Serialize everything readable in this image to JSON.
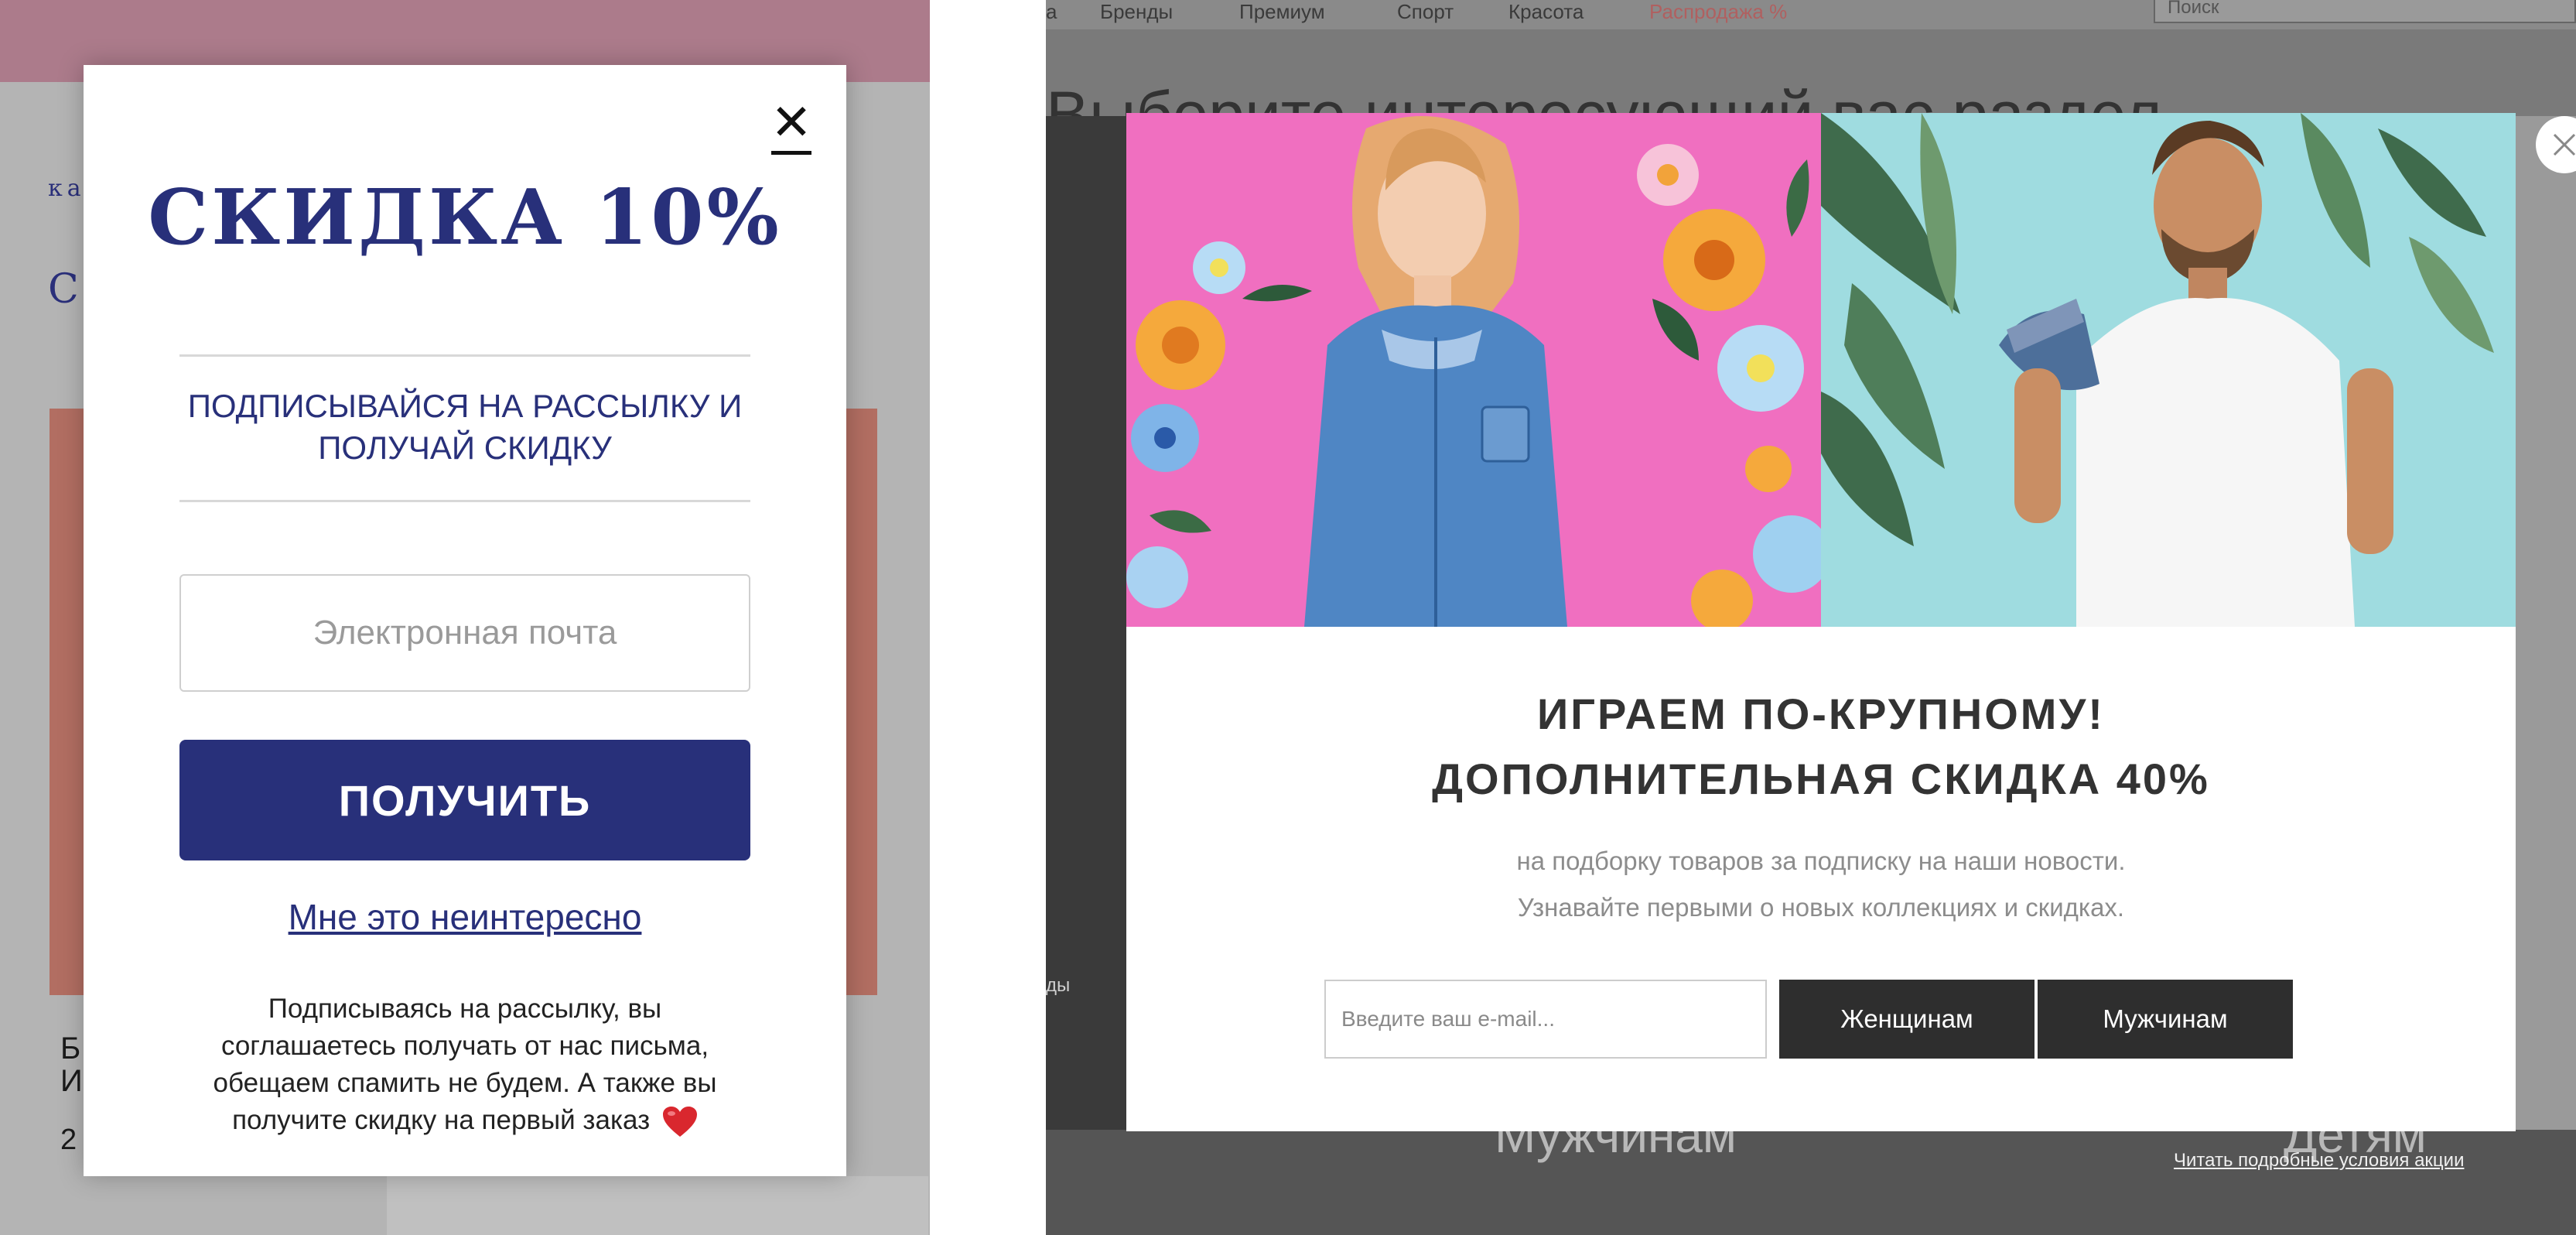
{
  "left_panel": {
    "background": {
      "text_ka": "ка",
      "text_c": "С",
      "text_b": "Б\nИ",
      "text_2": "2"
    },
    "popup": {
      "title": "СКИДКА 10%",
      "subtitle": "ПОДПИСЫВАЙСЯ НА РАССЫЛКУ И ПОЛУЧАЙ СКИДКУ",
      "email_placeholder": "Электронная почта",
      "email_value": "",
      "submit_label": "ПОЛУЧИТЬ",
      "decline_label": "Мне это неинтересно",
      "disclaimer": "Подписываясь на рассылку, вы соглашаетесь получать от нас письма, обещаем спамить не будем. А также вы получите скидку на первый заказ",
      "close_icon": "close-icon",
      "heart_icon": "heart-icon",
      "colors": {
        "brand": "#28307a",
        "topbar": "#ac7b8b",
        "overlay": "#b4b4b4"
      }
    }
  },
  "right_panel": {
    "background": {
      "nav_items": [
        "а",
        "Бренды",
        "Премиум",
        "Спорт",
        "Красота",
        "Распродажа %"
      ],
      "search_placeholder": "Поиск",
      "heading": "Выберите интересующий вас раздел",
      "side_label": "ды",
      "section_men": "Мужчинам",
      "section_kids": "Детям",
      "terms_link": "Читать подробные условия акции"
    },
    "popup": {
      "headline_1": "ИГРАЕМ ПО-КРУПНОМУ!",
      "headline_2": "ДОПОЛНИТЕЛЬНАЯ СКИДКА 40%",
      "desc_1": "на подборку товаров за подписку на наши новости.",
      "desc_2": "Узнавайте первыми о новых коллекциях и скидках.",
      "email_placeholder": "Введите ваш e-mail...",
      "email_value": "",
      "btn_women": "Женщинам",
      "btn_men": "Мужчинам",
      "close_icon": "close-circle-icon",
      "colors": {
        "button": "#2e2e2e",
        "headline": "#333333",
        "photo_left_bg": "#f06fc0",
        "photo_right_bg": "#9fdce0"
      }
    }
  }
}
